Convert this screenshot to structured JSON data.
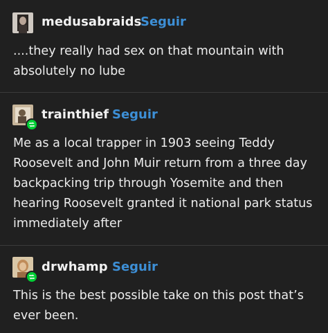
{
  "posts": [
    {
      "username": "medusabraids",
      "follow_label": "Seguir",
      "reblog": false,
      "text": "....they really had sex on that mountain with absolutely no lube"
    },
    {
      "username": "trainthief",
      "follow_label": "Seguir",
      "reblog": true,
      "text": "Me as a local trapper in 1903 seeing Teddy Roosevelt and John Muir return from a three day backpacking trip through Yosemite and then hearing Roosevelt granted it national park status immediately after"
    },
    {
      "username": "drwhamp",
      "follow_label": "Seguir",
      "reblog": true,
      "text": "This is the best possible take on this post that’s ever been."
    }
  ],
  "colors": {
    "background": "#202020",
    "follow": "#3d8fd6",
    "reblog_badge": "#00cf35",
    "divider": "#3a3a3a"
  }
}
